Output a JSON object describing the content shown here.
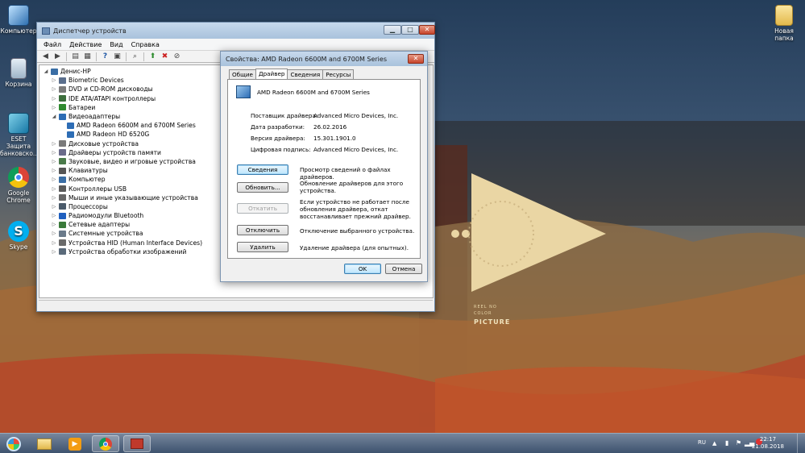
{
  "desktop": {
    "icons": [
      {
        "label": "Компьютер"
      },
      {
        "label": "Корзина"
      },
      {
        "label": "ESET Защита банковско..."
      },
      {
        "label": "Google Chrome"
      },
      {
        "label": "Skype"
      },
      {
        "label": "Новая папка"
      }
    ],
    "wallpaper_text": {
      "line1": "REEL NO",
      "line2": "COLOR",
      "line3": "PICTURE"
    }
  },
  "device_manager": {
    "title": "Диспетчер устройств",
    "menu": [
      "Файл",
      "Действие",
      "Вид",
      "Справка"
    ],
    "tree": {
      "root": "Денис-HP",
      "items": [
        {
          "label": "Biometric Devices",
          "color": "#5a6e8c"
        },
        {
          "label": "DVD и CD-ROM дисководы",
          "color": "#7b7b7b"
        },
        {
          "label": "IDE ATA/ATAPI контроллеры",
          "color": "#3c6e3c"
        },
        {
          "label": "Батареи",
          "color": "#2f8a2f"
        },
        {
          "label": "Видеоадаптеры",
          "color": "#2d6db5"
        },
        {
          "label": "Дисковые устройства",
          "color": "#7a7a7a"
        },
        {
          "label": "Драйверы устройств памяти",
          "color": "#6a6a8a"
        },
        {
          "label": "Звуковые, видео и игровые устройства",
          "color": "#4a7a4a"
        },
        {
          "label": "Клавиатуры",
          "color": "#555555"
        },
        {
          "label": "Компьютер",
          "color": "#3a6ea5"
        },
        {
          "label": "Контроллеры USB",
          "color": "#5a5a5a"
        },
        {
          "label": "Мыши и иные указывающие устройства",
          "color": "#666666"
        },
        {
          "label": "Процессоры",
          "color": "#4a5a6a"
        },
        {
          "label": "Радиомодули Bluetooth",
          "color": "#1f5fbf"
        },
        {
          "label": "Сетевые адаптеры",
          "color": "#3a7a3a"
        },
        {
          "label": "Системные устройства",
          "color": "#6a7a8a"
        },
        {
          "label": "Устройства HID (Human Interface Devices)",
          "color": "#6a6a6a"
        },
        {
          "label": "Устройства обработки изображений",
          "color": "#5a6a7a"
        }
      ],
      "video_children": [
        {
          "label": "AMD Radeon 6600M and 6700M Series"
        },
        {
          "label": "AMD Radeon HD 6520G"
        }
      ]
    }
  },
  "properties": {
    "title": "Свойства: AMD Radeon 6600M and 6700M Series",
    "tabs": [
      "Общие",
      "Драйвер",
      "Сведения",
      "Ресурсы"
    ],
    "active_tab": "Драйвер",
    "device_name": "AMD Radeon 6600M and 6700M Series",
    "fields": [
      {
        "label": "Поставщик драйвера:",
        "value": "Advanced Micro Devices, Inc."
      },
      {
        "label": "Дата разработки:",
        "value": "26.02.2016"
      },
      {
        "label": "Версия драйвера:",
        "value": "15.301.1901.0"
      },
      {
        "label": "Цифровая подпись:",
        "value": "Advanced Micro Devices, Inc."
      }
    ],
    "actions": [
      {
        "button": "Сведения",
        "description": "Просмотр сведений о файлах драйверов."
      },
      {
        "button": "Обновить...",
        "description": "Обновление драйверов для этого устройства."
      },
      {
        "button": "Откатить",
        "description": "Если устройство не работает после обновления драйвера, откат восстанавливает прежний драйвер."
      },
      {
        "button": "Отключить",
        "description": "Отключение выбранного устройства."
      },
      {
        "button": "Удалить",
        "description": "Удаление драйвера (для опытных)."
      }
    ],
    "ok": "OK",
    "cancel": "Отмена"
  },
  "taskbar": {
    "lang": "RU",
    "time": "22:17",
    "date": "21.08.2018"
  }
}
